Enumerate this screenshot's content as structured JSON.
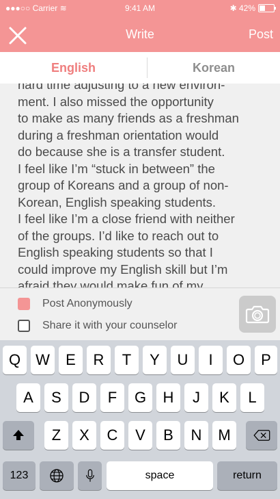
{
  "status_bar": {
    "carrier": "●●●○○ Carrier ≋",
    "time": "9:41 AM",
    "battery": "✱ 42%"
  },
  "header": {
    "title": "Write",
    "post_label": "Post"
  },
  "tabs": {
    "english": "English",
    "korean": "Korean"
  },
  "body_text": "hard time adjusting to a new environ-\nment. I also missed the opportunity\nto make as many friends as a freshman\nduring a freshman orientation would\ndo because she is a transfer student.\nI feel like I’m “stuck in between” the\ngroup of Koreans and a group of non-\nKorean, English speaking students.\nI feel like I’m a close friend with neither\nof the groups. I’d like to reach out to\nEnglish speaking students so that I\ncould improve my English skill but I’m\nafraid they would make fun of my",
  "options": {
    "anonymous": "Post Anonymously",
    "counselor": "Share it with your counselor"
  },
  "keyboard": {
    "row1": [
      "Q",
      "W",
      "E",
      "R",
      "T",
      "Y",
      "U",
      "I",
      "O",
      "P"
    ],
    "row2": [
      "A",
      "S",
      "D",
      "F",
      "G",
      "H",
      "J",
      "K",
      "L"
    ],
    "row3": [
      "Z",
      "X",
      "C",
      "V",
      "B",
      "N",
      "M"
    ],
    "numbers": "123",
    "space": "space",
    "return": "return"
  }
}
